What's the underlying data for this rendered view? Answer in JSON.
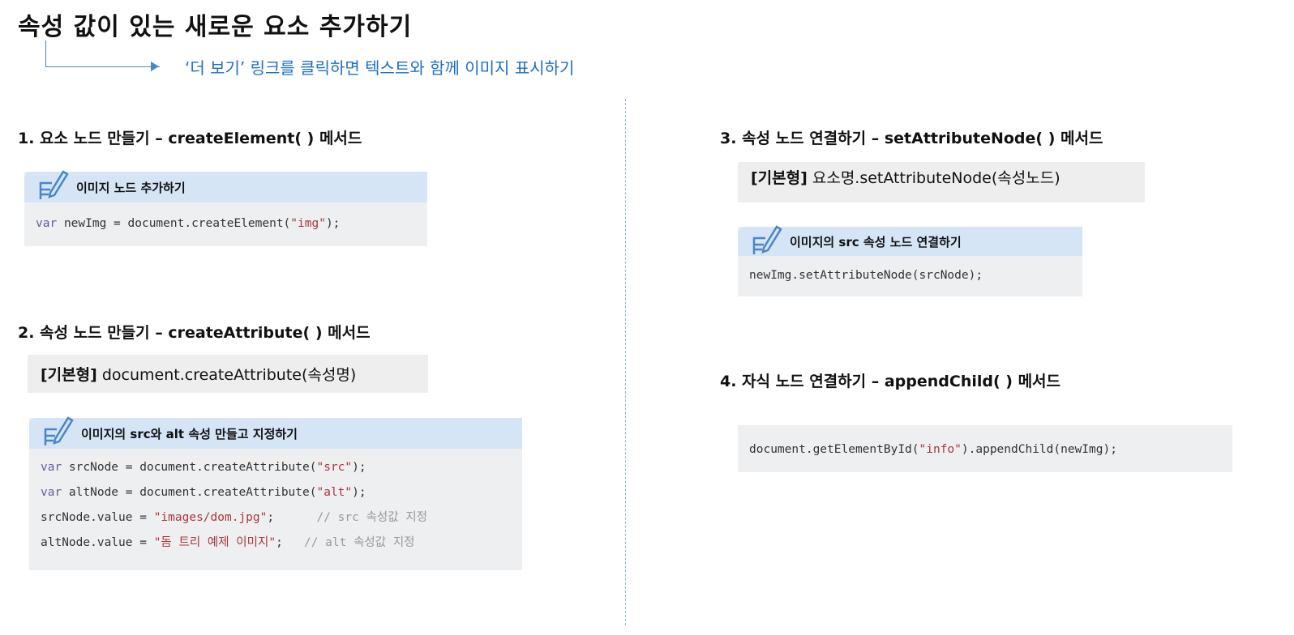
{
  "title": "속성 값이 있는 새로운 요소 추가하기",
  "subtitle": "‘더 보기’ 링크를 클릭하면 텍스트와 함께 이미지 표시하기",
  "s1": {
    "heading": "1. 요소 노드 만들기 – createElement( ) 메서드",
    "box_title": "이미지 노드 추가하기",
    "code": [
      "var",
      "newImg = document.createElement(",
      "\"img\"",
      ");"
    ]
  },
  "s2": {
    "heading": "2. 속성 노드 만들기 – createAttribute( ) 메서드",
    "basic_label": "[기본형]",
    "basic_text": "document.createAttribute(속성명)",
    "box_title": "이미지의 src와 alt 속성 만들고 지정하기",
    "lines": [
      {
        "kw": "var",
        "a": " srcNode = document.createAttribute(",
        "s": "\"src\"",
        "b": ");",
        "c": ""
      },
      {
        "kw": "var",
        "a": " altNode = document.createAttribute(",
        "s": "\"alt\"",
        "b": ");",
        "c": ""
      },
      {
        "kw": "",
        "a": "srcNode.value = ",
        "s": "\"images/dom.jpg\"",
        "b": ";      ",
        "c": "// src 속성값 지정"
      },
      {
        "kw": "",
        "a": "altNode.value = ",
        "s": "\"돔 트리 예제 이미지\"",
        "b": ";   ",
        "c": "// alt 속성값 지정"
      }
    ]
  },
  "s3": {
    "heading": "3. 속성 노드 연결하기 – setAttributeNode( ) 메서드",
    "basic_label": "[기본형]",
    "basic_text": "요소명.setAttributeNode(속성노드)",
    "box_title": "이미지의 src 속성 노드 연결하기",
    "code": "newImg.setAttributeNode(srcNode);"
  },
  "s4": {
    "heading": "4. 자식 노드 연결하기 – appendChild( ) 메서드",
    "code_a": "document.getElementById(",
    "code_s": "\"info\"",
    "code_b": ").appendChild(newImg);"
  }
}
